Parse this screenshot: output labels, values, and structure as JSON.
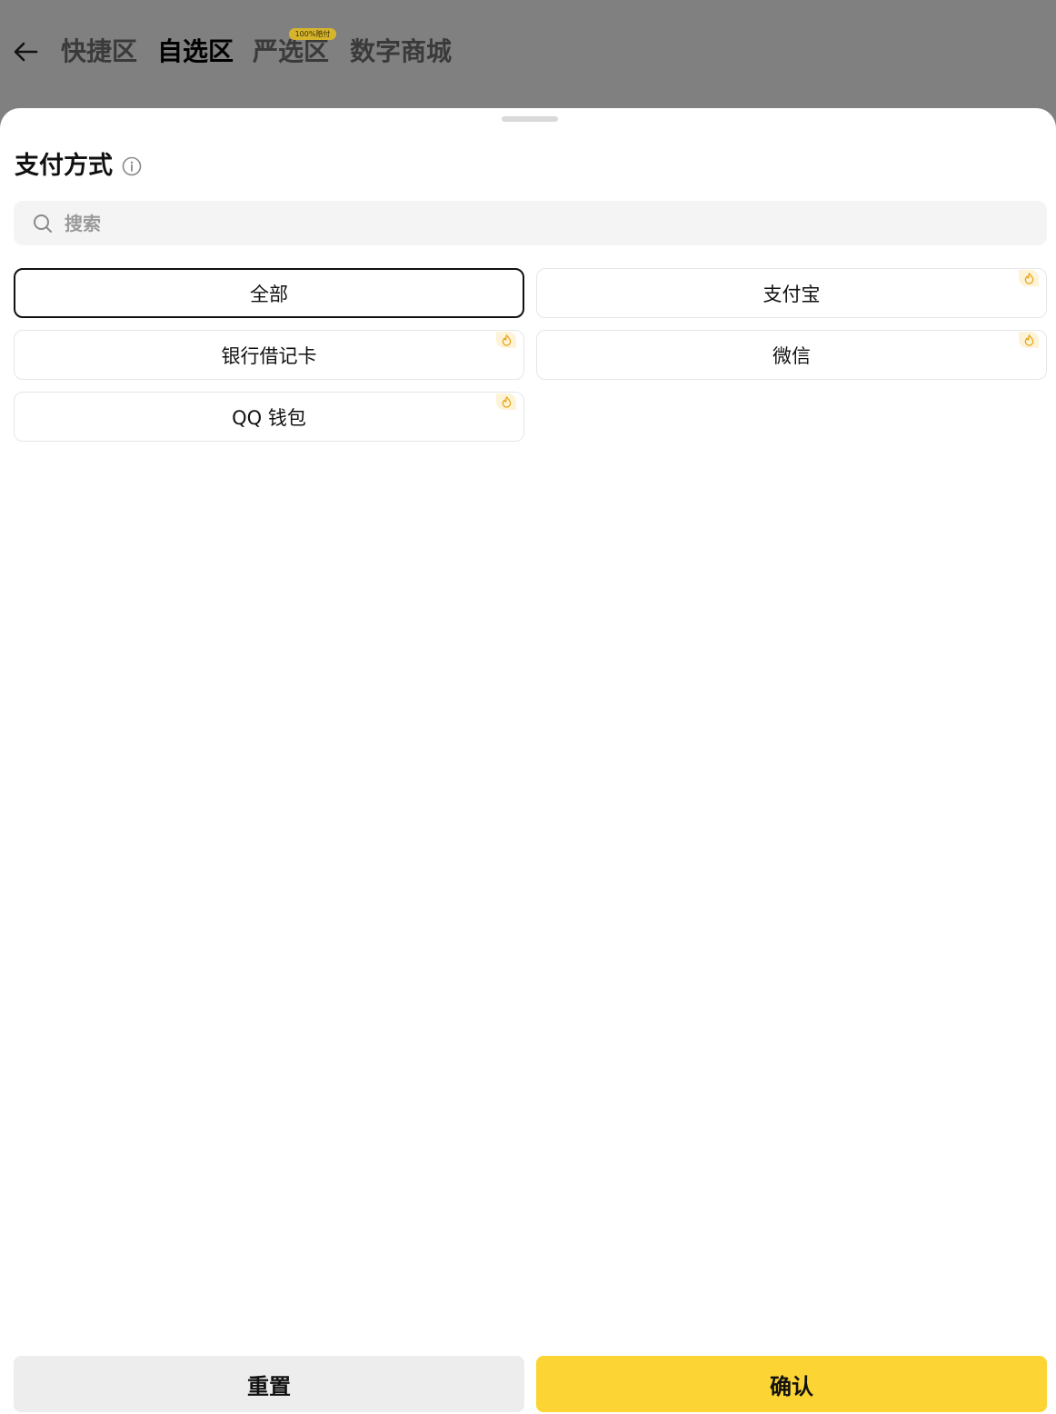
{
  "header": {
    "tabs": [
      {
        "label": "快捷区",
        "active": false
      },
      {
        "label": "自选区",
        "active": true
      },
      {
        "label": "严选区",
        "active": false,
        "badge": "100%赔付"
      },
      {
        "label": "数字商城",
        "active": false
      }
    ]
  },
  "sheet": {
    "title": "支付方式",
    "search": {
      "placeholder": "搜索",
      "value": ""
    },
    "options": [
      {
        "label": "全部",
        "selected": true,
        "hot": false
      },
      {
        "label": "支付宝",
        "selected": false,
        "hot": true
      },
      {
        "label": "银行借记卡",
        "selected": false,
        "hot": true
      },
      {
        "label": "微信",
        "selected": false,
        "hot": true
      },
      {
        "label": "QQ 钱包",
        "selected": false,
        "hot": true
      }
    ],
    "reset_label": "重置",
    "confirm_label": "确认"
  },
  "colors": {
    "accent": "#fcd535",
    "hot_icon": "#e8a317",
    "overlay": "#808080"
  },
  "icons": {
    "back": "arrow-left-icon",
    "info": "info-circle-icon",
    "search": "search-icon",
    "hot": "fire-icon"
  }
}
